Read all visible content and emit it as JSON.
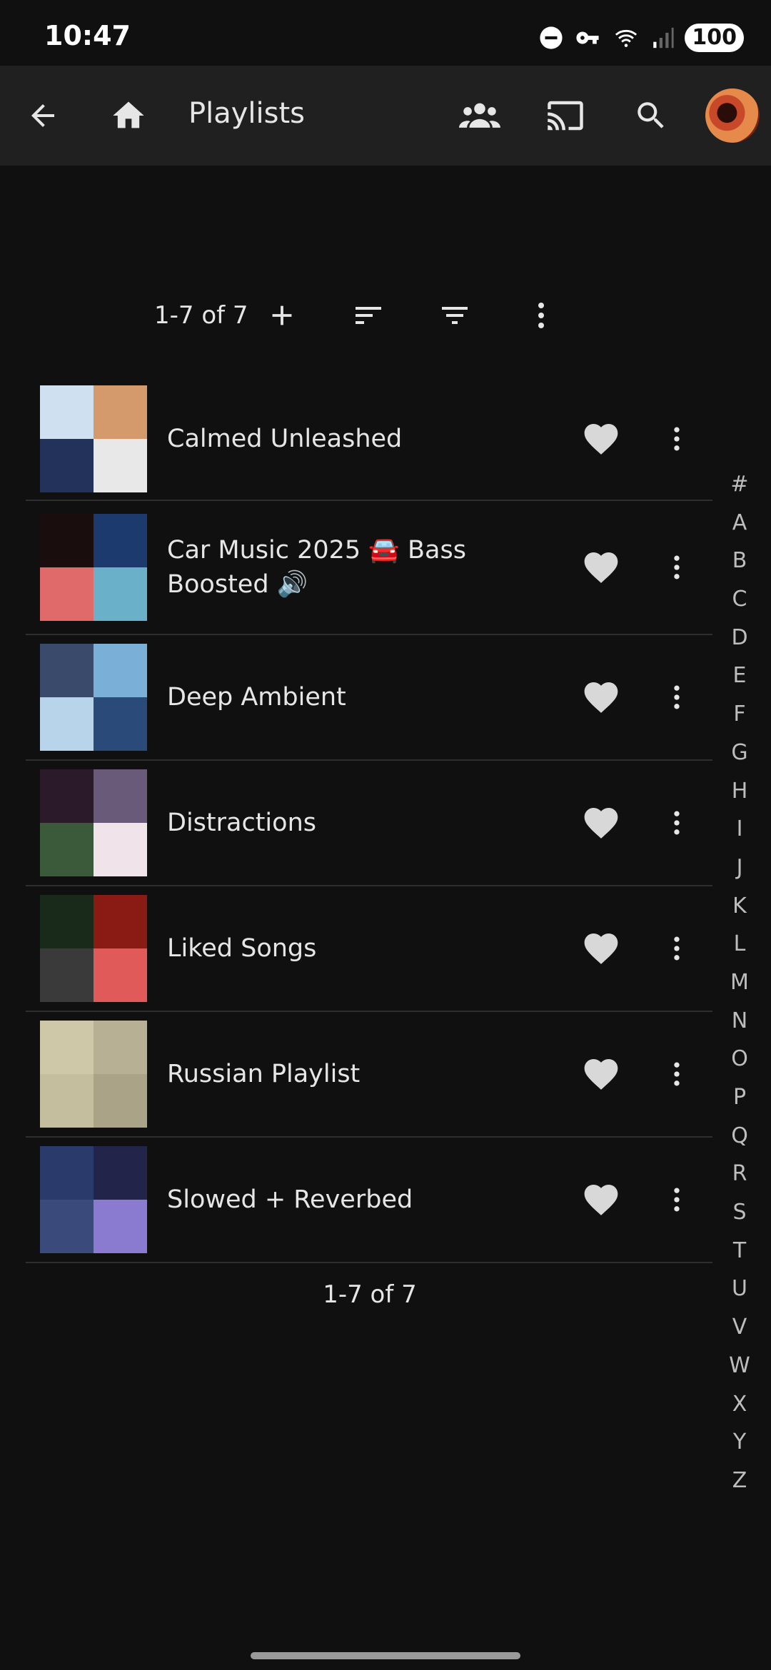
{
  "status_bar": {
    "time": "10:47",
    "battery": "100",
    "network": "5"
  },
  "app_bar": {
    "title": "Playlists",
    "icons": [
      "back-arrow-icon",
      "home-icon",
      "people-icon",
      "cast-icon",
      "search-icon"
    ]
  },
  "toolbar": {
    "count": "1-7 of 7"
  },
  "playlists": [
    {
      "title": "Calmed Unleashed",
      "colors": [
        "#cfe0f0",
        "#d49a6c",
        "#22325a",
        "#e8e8e8"
      ]
    },
    {
      "title": "Car Music 2025 🚘 Bass Boosted 🔊",
      "colors": [
        "#1a0d0d",
        "#1c3a6e",
        "#e06a6a",
        "#6ab0c8"
      ]
    },
    {
      "title": "Deep Ambient",
      "colors": [
        "#3a4a6a",
        "#7ab0d8",
        "#b8d4ea",
        "#2a4a7a"
      ]
    },
    {
      "title": "Distractions",
      "colors": [
        "#2a1a2a",
        "#6a5a7a",
        "#3a5a3a",
        "#f0e4ea"
      ]
    },
    {
      "title": "Liked Songs",
      "colors": [
        "#1a2a1a",
        "#8a1a14",
        "#3a3a3a",
        "#e05a5a"
      ]
    },
    {
      "title": "Russian Playlist",
      "colors": [
        "#cfc8a8",
        "#b8b094",
        "#c4bd9e",
        "#aaa388"
      ]
    },
    {
      "title": "Slowed + Reverbed",
      "colors": [
        "#2a3a6a",
        "#22244a",
        "#3a4a7a",
        "#8a7ad0"
      ]
    }
  ],
  "footer": {
    "count": "1-7 of 7"
  },
  "alphabet": [
    "#",
    "A",
    "B",
    "C",
    "D",
    "E",
    "F",
    "G",
    "H",
    "I",
    "J",
    "K",
    "L",
    "M",
    "N",
    "O",
    "P",
    "Q",
    "R",
    "S",
    "T",
    "U",
    "V",
    "W",
    "X",
    "Y",
    "Z"
  ]
}
